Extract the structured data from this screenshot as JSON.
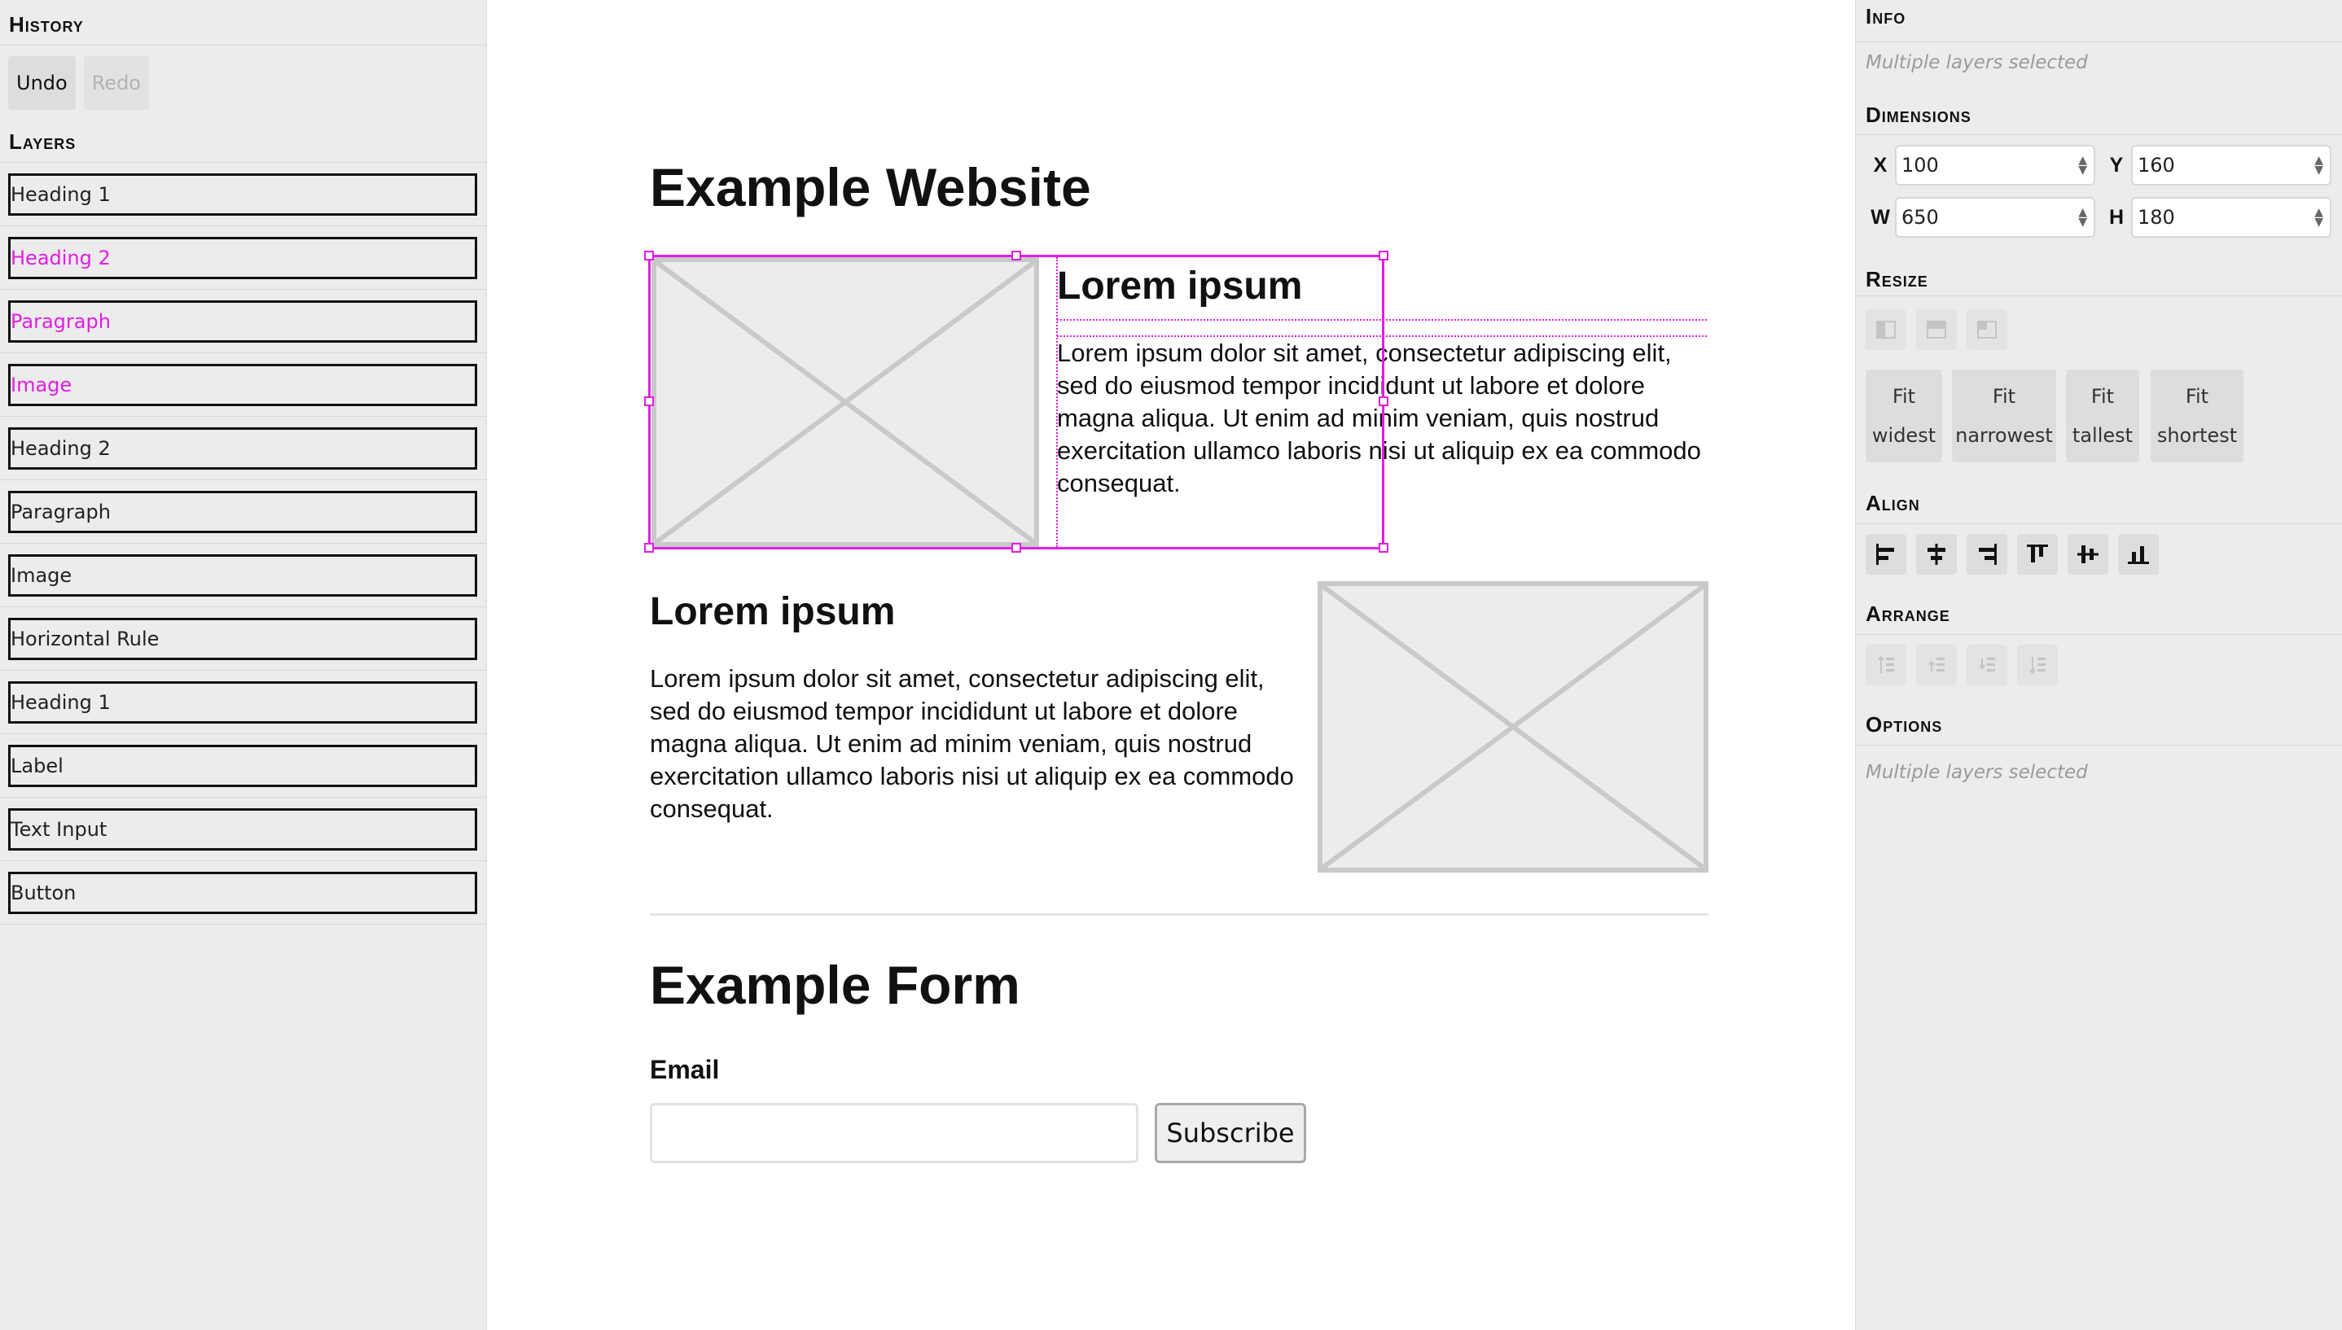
{
  "history": {
    "title": "History",
    "undo_label": "Undo",
    "redo_label": "Redo"
  },
  "layers": {
    "title": "Layers",
    "items": [
      {
        "label": "Heading 1",
        "selected": false
      },
      {
        "label": "Heading 2",
        "selected": true
      },
      {
        "label": "Paragraph",
        "selected": true
      },
      {
        "label": "Image",
        "selected": true
      },
      {
        "label": "Heading 2",
        "selected": false
      },
      {
        "label": "Paragraph",
        "selected": false
      },
      {
        "label": "Image",
        "selected": false
      },
      {
        "label": "Horizontal Rule",
        "selected": false
      },
      {
        "label": "Heading 1",
        "selected": false
      },
      {
        "label": "Label",
        "selected": false
      },
      {
        "label": "Text Input",
        "selected": false
      },
      {
        "label": "Button",
        "selected": false
      }
    ]
  },
  "canvas": {
    "site_title": "Example Website",
    "section1": {
      "heading": "Lorem ipsum",
      "paragraph": "Lorem ipsum dolor sit amet, consectetur adipiscing elit, sed do eiusmod tempor incididunt ut labore et dolore magna aliqua. Ut enim ad minim veniam, quis nostrud exercitation ullamco laboris nisi ut aliquip ex ea commodo consequat."
    },
    "section2": {
      "heading": "Lorem ipsum",
      "paragraph": "Lorem ipsum dolor sit amet, consectetur adipiscing elit, sed do eiusmod tempor incididunt ut labore et dolore magna aliqua. Ut enim ad minim veniam, quis nostrud exercitation ullamco laboris nisi ut aliquip ex ea commodo consequat."
    },
    "form": {
      "title": "Example Form",
      "email_label": "Email",
      "email_value": "",
      "subscribe_label": "Subscribe"
    }
  },
  "info": {
    "title": "Info",
    "status": "Multiple layers selected"
  },
  "dimensions": {
    "title": "Dimensions",
    "x_label": "X",
    "x_value": "100",
    "y_label": "Y",
    "y_value": "160",
    "w_label": "W",
    "w_value": "650",
    "h_label": "H",
    "h_value": "180"
  },
  "resize": {
    "title": "Resize",
    "fit": [
      {
        "line1": "Fit",
        "line2": "widest"
      },
      {
        "line1": "Fit",
        "line2": "narrowest"
      },
      {
        "line1": "Fit",
        "line2": "tallest"
      },
      {
        "line1": "Fit",
        "line2": "shortest"
      }
    ]
  },
  "align": {
    "title": "Align"
  },
  "arrange": {
    "title": "Arrange"
  },
  "options": {
    "title": "Options",
    "status": "Multiple layers selected"
  },
  "colors": {
    "selection": "#e21ee2",
    "panel_bg": "#ececec",
    "placeholder_stroke": "#c9c9c9"
  }
}
